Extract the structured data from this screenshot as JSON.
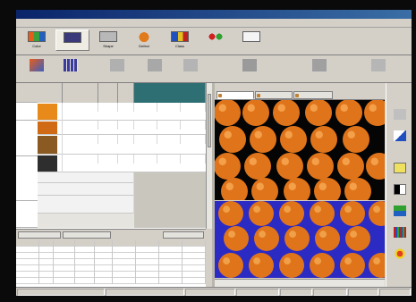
{
  "window": {
    "title": ""
  },
  "menu": {
    "items": [
      "",
      "",
      "",
      "",
      "",
      "",
      "",
      ""
    ]
  },
  "modes": [
    {
      "icon": "color-icon",
      "label": "Color"
    },
    {
      "icon": "grading-icon",
      "label": ""
    },
    {
      "icon": "shape-icon",
      "label": "Shape"
    },
    {
      "icon": "defect-icon",
      "label": "Defect"
    },
    {
      "icon": "class-icon",
      "label": "Class"
    },
    {
      "icon": "weight-icon",
      "label": ""
    },
    {
      "icon": "info-icon",
      "label": ""
    }
  ],
  "toolbar": [
    {
      "icon": "image-icon",
      "label": ""
    },
    {
      "icon": "grid-icon",
      "label": ""
    },
    {
      "icon": "select-icon",
      "label": ""
    },
    {
      "icon": "new-icon",
      "label": ""
    },
    {
      "icon": "edit-icon",
      "label": ""
    },
    {
      "icon": "grade-icon",
      "label": ""
    },
    {
      "icon": "apply-changes-icon",
      "label": ""
    },
    {
      "icon": "discard-icon",
      "label": ""
    }
  ],
  "grid": {
    "categories": [
      "",
      "",
      "",
      ""
    ],
    "headers": [
      "",
      "",
      "",
      "",
      "",
      ""
    ],
    "rows": [
      {
        "swatch": "#e88a1a",
        "c1": "",
        "c2": "",
        "c3": "",
        "c4": "",
        "c5": "",
        "c6": ""
      },
      {
        "swatch": "#d06a14",
        "c1": "",
        "c2": "",
        "c3": "",
        "c4": "",
        "c5": "",
        "c6": ""
      },
      {
        "swatch": "#8a5a22",
        "c1": "",
        "c2": "",
        "c3": "",
        "c4": "",
        "c5": "",
        "c6": ""
      },
      {
        "swatch": "#2e2e2e",
        "c1": "",
        "c2": "",
        "c3": "",
        "c4": "",
        "c5": "",
        "c6": ""
      },
      {
        "swatch": "",
        "c1": "",
        "c2": "",
        "c3": "",
        "c4": "",
        "c5": "",
        "c6": ""
      },
      {
        "swatch": "",
        "c1": "",
        "c2": "",
        "c3": "",
        "c4": "",
        "c5": "",
        "c6": ""
      }
    ],
    "lower_rows": [
      "",
      "",
      ""
    ]
  },
  "lower_tabs": [
    "",
    "",
    ""
  ],
  "results": {
    "headers": [
      "",
      "",
      "",
      "",
      "",
      "",
      "",
      "",
      ""
    ],
    "rows": [
      [
        "",
        "",
        "",
        "",
        "",
        "",
        "",
        "",
        ""
      ],
      [
        "",
        "",
        "",
        "",
        "",
        "",
        "",
        "",
        ""
      ],
      [
        "",
        "",
        "",
        "",
        "",
        "",
        "",
        "",
        ""
      ],
      [
        "",
        "",
        "",
        "",
        "",
        "",
        "",
        "",
        ""
      ],
      [
        "",
        "",
        "",
        "",
        "",
        "",
        "",
        "",
        ""
      ],
      [
        "",
        "",
        "",
        "",
        "",
        "",
        "",
        "",
        ""
      ]
    ]
  },
  "image_view": {
    "menu": [
      "",
      "",
      "",
      ""
    ],
    "tabs": [
      "",
      "",
      ""
    ]
  },
  "side_tools": [
    {
      "icon": "stop-icon",
      "label": ""
    },
    {
      "icon": "graph-icon",
      "label": ""
    },
    {
      "icon": "edit-icon",
      "label": ""
    },
    {
      "icon": "contrast-icon",
      "label": ""
    },
    {
      "icon": "chart-icon",
      "label": ""
    },
    {
      "icon": "palette-icon",
      "label": ""
    },
    {
      "icon": "highlight-icon",
      "label": ""
    }
  ],
  "status": [
    "",
    "",
    "",
    "",
    "",
    "",
    "",
    ""
  ],
  "colors": {
    "accent": "#2e6f74",
    "title": "#0a246a",
    "fruit": "#e0741a",
    "mask": "#2b2bc4"
  }
}
